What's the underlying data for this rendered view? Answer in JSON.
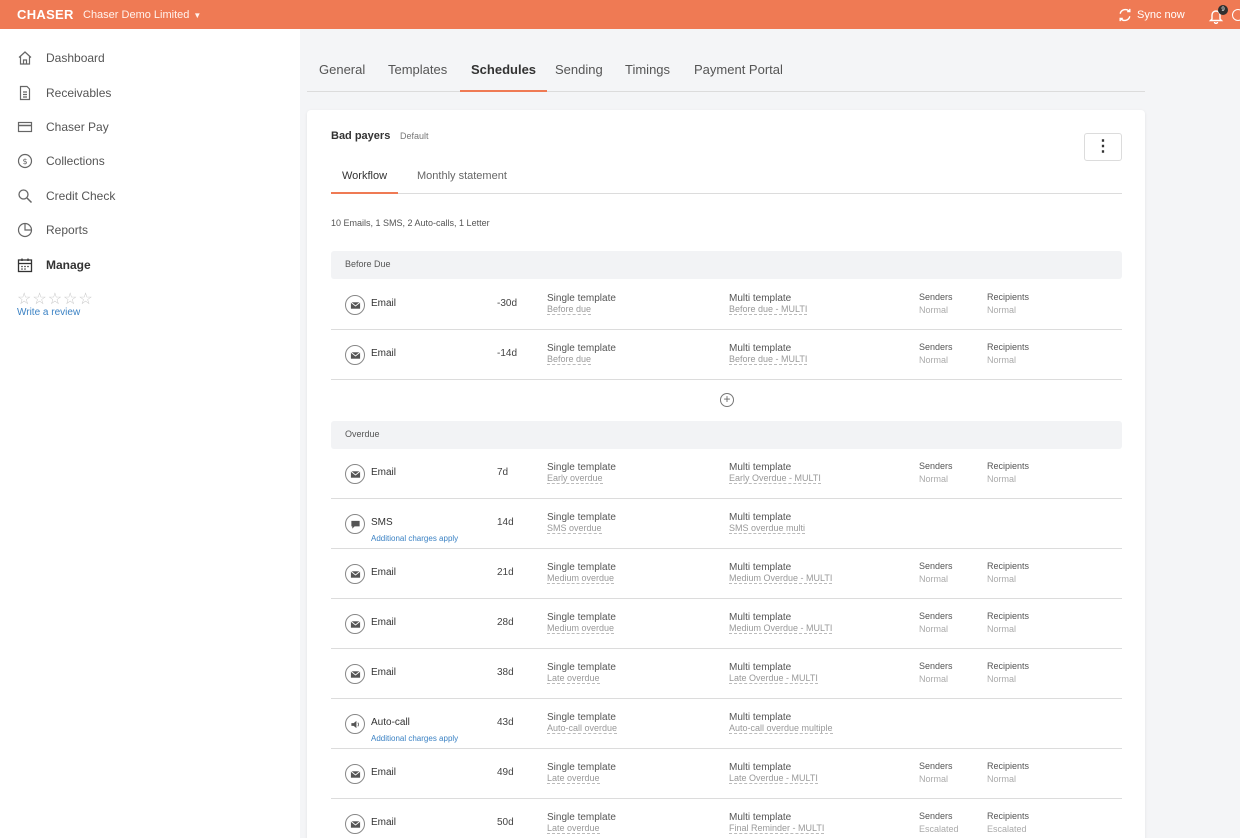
{
  "topbar": {
    "logo": "CHASER",
    "company": "Chaser Demo Limited",
    "sync_label": "Sync now",
    "notification_count": "9",
    "colors": {
      "brand": "#ef7a54"
    }
  },
  "sidebar": {
    "items": [
      {
        "label": "Dashboard",
        "icon": "home-icon"
      },
      {
        "label": "Receivables",
        "icon": "document-icon"
      },
      {
        "label": "Chaser Pay",
        "icon": "credit-card-icon"
      },
      {
        "label": "Collections",
        "icon": "dollar-circle-icon"
      },
      {
        "label": "Credit Check",
        "icon": "search-icon"
      },
      {
        "label": "Reports",
        "icon": "pie-chart-icon"
      },
      {
        "label": "Manage",
        "icon": "calendar-icon"
      }
    ],
    "stars": "☆☆☆☆☆",
    "review_link": "Write a review"
  },
  "tabs": [
    "General",
    "Templates",
    "Schedules",
    "Sending",
    "Timings",
    "Payment Portal"
  ],
  "active_tab": "Schedules",
  "card": {
    "title": "Bad payers",
    "default_label": "Default",
    "menu_glyph": "⋮",
    "subtabs": [
      "Workflow",
      "Monthly statement"
    ],
    "summary": "10 Emails, 1 SMS, 2 Auto-calls, 1 Letter",
    "add_glyph": "+",
    "sections": {
      "before_due": {
        "label": "Before Due",
        "rows": [
          {
            "type": "Email",
            "day": "-30d",
            "single_label": "Single template",
            "single": "Before due",
            "multi_label": "Multi template",
            "multi": "Before due - MULTI",
            "senders_label": "Senders",
            "senders": "Normal",
            "recipients_label": "Recipients",
            "recipients": "Normal"
          },
          {
            "type": "Email",
            "day": "-14d",
            "single_label": "Single template",
            "single": "Before due",
            "multi_label": "Multi template",
            "multi": "Before due - MULTI",
            "senders_label": "Senders",
            "senders": "Normal",
            "recipients_label": "Recipients",
            "recipients": "Normal"
          }
        ]
      },
      "overdue": {
        "label": "Overdue",
        "rows": [
          {
            "type": "Email",
            "day": "7d",
            "single_label": "Single template",
            "single": "Early overdue",
            "multi_label": "Multi template",
            "multi": "Early Overdue - MULTI",
            "senders_label": "Senders",
            "senders": "Normal",
            "recipients_label": "Recipients",
            "recipients": "Normal"
          },
          {
            "type": "SMS",
            "day": "14d",
            "charge": "Additional charges apply",
            "single_label": "Single template",
            "single": "SMS overdue",
            "multi_label": "Multi template",
            "multi": "SMS overdue multi"
          },
          {
            "type": "Email",
            "day": "21d",
            "single_label": "Single template",
            "single": "Medium overdue",
            "multi_label": "Multi template",
            "multi": "Medium Overdue - MULTI",
            "senders_label": "Senders",
            "senders": "Normal",
            "recipients_label": "Recipients",
            "recipients": "Normal"
          },
          {
            "type": "Email",
            "day": "28d",
            "single_label": "Single template",
            "single": "Medium overdue",
            "multi_label": "Multi template",
            "multi": "Medium Overdue - MULTI",
            "senders_label": "Senders",
            "senders": "Normal",
            "recipients_label": "Recipients",
            "recipients": "Normal"
          },
          {
            "type": "Email",
            "day": "38d",
            "single_label": "Single template",
            "single": "Late overdue",
            "multi_label": "Multi template",
            "multi": "Late Overdue - MULTI",
            "senders_label": "Senders",
            "senders": "Normal",
            "recipients_label": "Recipients",
            "recipients": "Normal"
          },
          {
            "type": "Auto-call",
            "day": "43d",
            "charge": "Additional charges apply",
            "single_label": "Single template",
            "single": "Auto-call overdue",
            "multi_label": "Multi template",
            "multi": "Auto-call overdue multiple"
          },
          {
            "type": "Email",
            "day": "49d",
            "single_label": "Single template",
            "single": "Late overdue",
            "multi_label": "Multi template",
            "multi": "Late Overdue - MULTI",
            "senders_label": "Senders",
            "senders": "Normal",
            "recipients_label": "Recipients",
            "recipients": "Normal"
          },
          {
            "type": "Email",
            "day": "50d",
            "single_label": "Single template",
            "single": "Late overdue",
            "multi_label": "Multi template",
            "multi": "Final Reminder - MULTI",
            "senders_label": "Senders",
            "senders": "Escalated",
            "recipients_label": "Recipients",
            "recipients": "Escalated"
          }
        ]
      }
    }
  }
}
